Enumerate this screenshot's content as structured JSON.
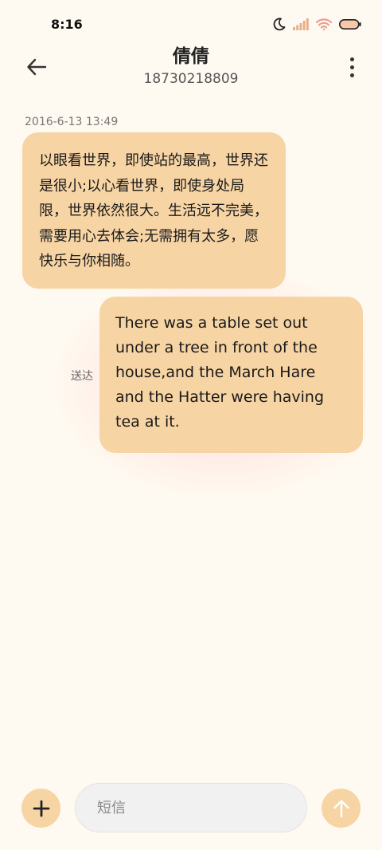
{
  "status_bar": {
    "time": "8:16",
    "icons": [
      "moon-icon",
      "signal-icon",
      "wifi-icon",
      "battery-icon"
    ]
  },
  "header": {
    "contact_name": "倩倩",
    "contact_number": "18730218809",
    "back_icon": "arrow-left-icon",
    "more_icon": "more-vertical-icon"
  },
  "conversation": {
    "timestamp": "2016-6-13 13:49",
    "messages": [
      {
        "direction": "incoming",
        "text": "以眼看世界，即使站的最高，世界还是很小;以心看世界，即使身处局限，世界依然很大。生活远不完美，需要用心去体会;无需拥有太多，愿快乐与你相随。"
      },
      {
        "direction": "outgoing",
        "text": "There was a table set out under a tree in front of the house,and the March Hare and the Hatter were having tea at it.",
        "status": "送达"
      }
    ]
  },
  "composer": {
    "placeholder": "短信",
    "value": "",
    "add_icon": "plus-icon",
    "send_icon": "arrow-up-icon"
  },
  "colors": {
    "background": "#FFFAF1",
    "bubble": "#F7D4A4",
    "input_bg": "#F1F1F1",
    "glow": "#FFB0B8"
  }
}
